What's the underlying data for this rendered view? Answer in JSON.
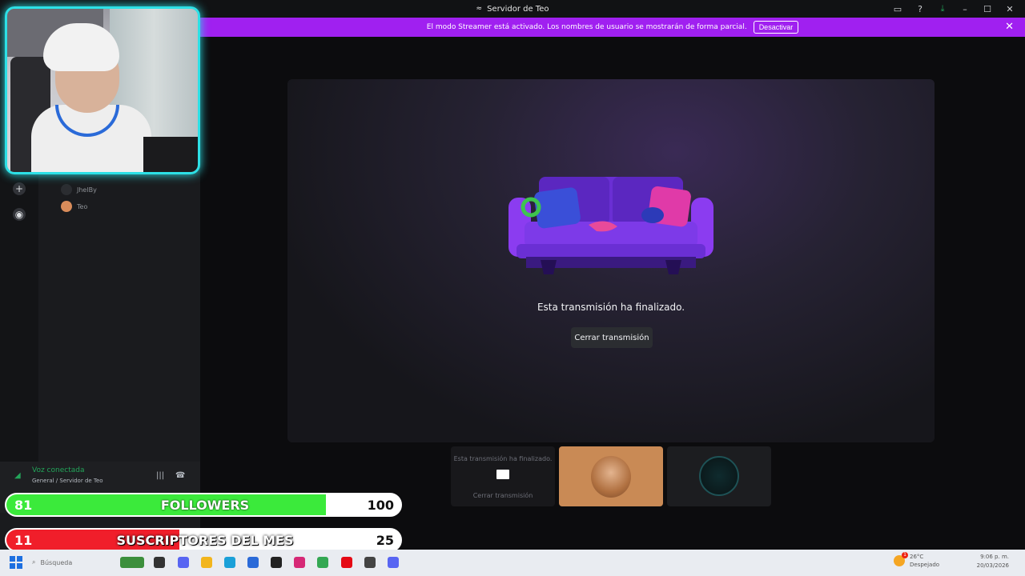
{
  "window": {
    "title": "Servidor de Teo",
    "icon": "discord-icon",
    "controls": [
      "inbox-icon",
      "help-icon",
      "download-icon",
      "minimize-icon",
      "maximize-icon",
      "close-icon"
    ]
  },
  "banner": {
    "message": "El modo Streamer está activado. Los nombres de usuario se mostrarán de forma parcial.",
    "button_label": "Desactivar",
    "close_glyph": "✕",
    "color": "#a020f0"
  },
  "sidebar": {
    "rail_buttons": [
      {
        "icon": "add-server-icon",
        "glyph": "+"
      },
      {
        "icon": "explore-icon",
        "glyph": "◉"
      }
    ],
    "members": [
      {
        "name": "JhelBy"
      },
      {
        "name": "Teo"
      }
    ]
  },
  "voice": {
    "status": "Voz conectada",
    "channel": "General / Servidor de Teo",
    "status_color": "#23a55a"
  },
  "stage": {
    "ended_text": "Esta transmisión ha finalizado.",
    "close_button": "Cerrar transmisión"
  },
  "tiles": [
    {
      "kind": "stream-ended",
      "text": "Esta transmisión ha finalizado.",
      "button": "Cerrar transmisión"
    },
    {
      "kind": "user-avatar"
    },
    {
      "kind": "user-logo"
    }
  ],
  "overlay": {
    "followers": {
      "current": "81",
      "label": "FOLLOWERS",
      "goal": "100",
      "progress": 0.81,
      "color": "#3bea3b"
    },
    "subs": {
      "current": "11",
      "label": "SUSCRIPTORES DEL MES",
      "goal": "25",
      "progress": 0.44,
      "color": "#f01e2a"
    }
  },
  "taskbar": {
    "search_placeholder": "Búsqueda",
    "weather_temp": "26°C",
    "weather_desc": "Despejado",
    "weather_badge": "1",
    "time": "9:06 p. m.",
    "date": "20/03/2026"
  }
}
